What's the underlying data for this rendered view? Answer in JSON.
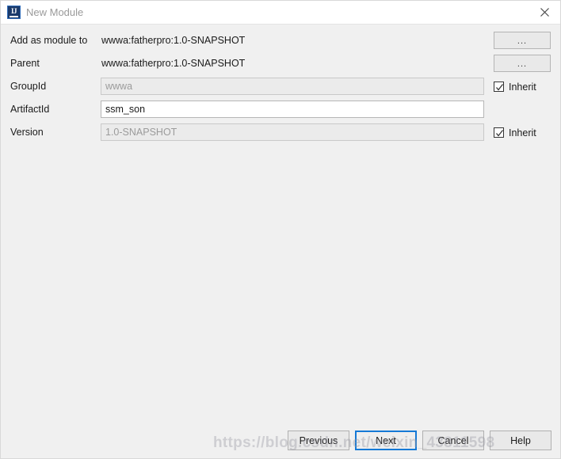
{
  "window": {
    "title": "New Module",
    "app_icon": "intellij-idea-icon",
    "close_icon": "close-icon"
  },
  "form": {
    "rows": [
      {
        "label": "Add as module to",
        "type": "text-value",
        "value": "wwwa:fatherpro:1.0-SNAPSHOT",
        "button": "...",
        "name": "add-as-module-to"
      },
      {
        "label": "Parent",
        "type": "text-value",
        "value": "wwwa:fatherpro:1.0-SNAPSHOT",
        "button": "...",
        "name": "parent"
      },
      {
        "label": "GroupId",
        "type": "input",
        "value": "wwwa",
        "disabled": true,
        "inherit_label": "Inherit",
        "inherit_checked": true,
        "name": "group-id"
      },
      {
        "label": "ArtifactId",
        "type": "input",
        "value": "ssm_son",
        "disabled": false,
        "name": "artifact-id"
      },
      {
        "label": "Version",
        "type": "input",
        "value": "1.0-SNAPSHOT",
        "disabled": true,
        "inherit_label": "Inherit",
        "inherit_checked": true,
        "name": "version"
      }
    ]
  },
  "buttons": {
    "previous": "Previous",
    "next": "Next",
    "cancel": "Cancel",
    "help": "Help"
  },
  "watermark": {
    "text": "https://blog.csdn.net/weixin_438​11598"
  },
  "colors": {
    "window_background": "#f0f0f0",
    "titlebar_background": "#ffffff",
    "focus_border": "#1579d6",
    "disabled_field_background": "#ebebeb",
    "disabled_field_text": "#9b9b9b",
    "title_text": "#9a9a9a"
  }
}
